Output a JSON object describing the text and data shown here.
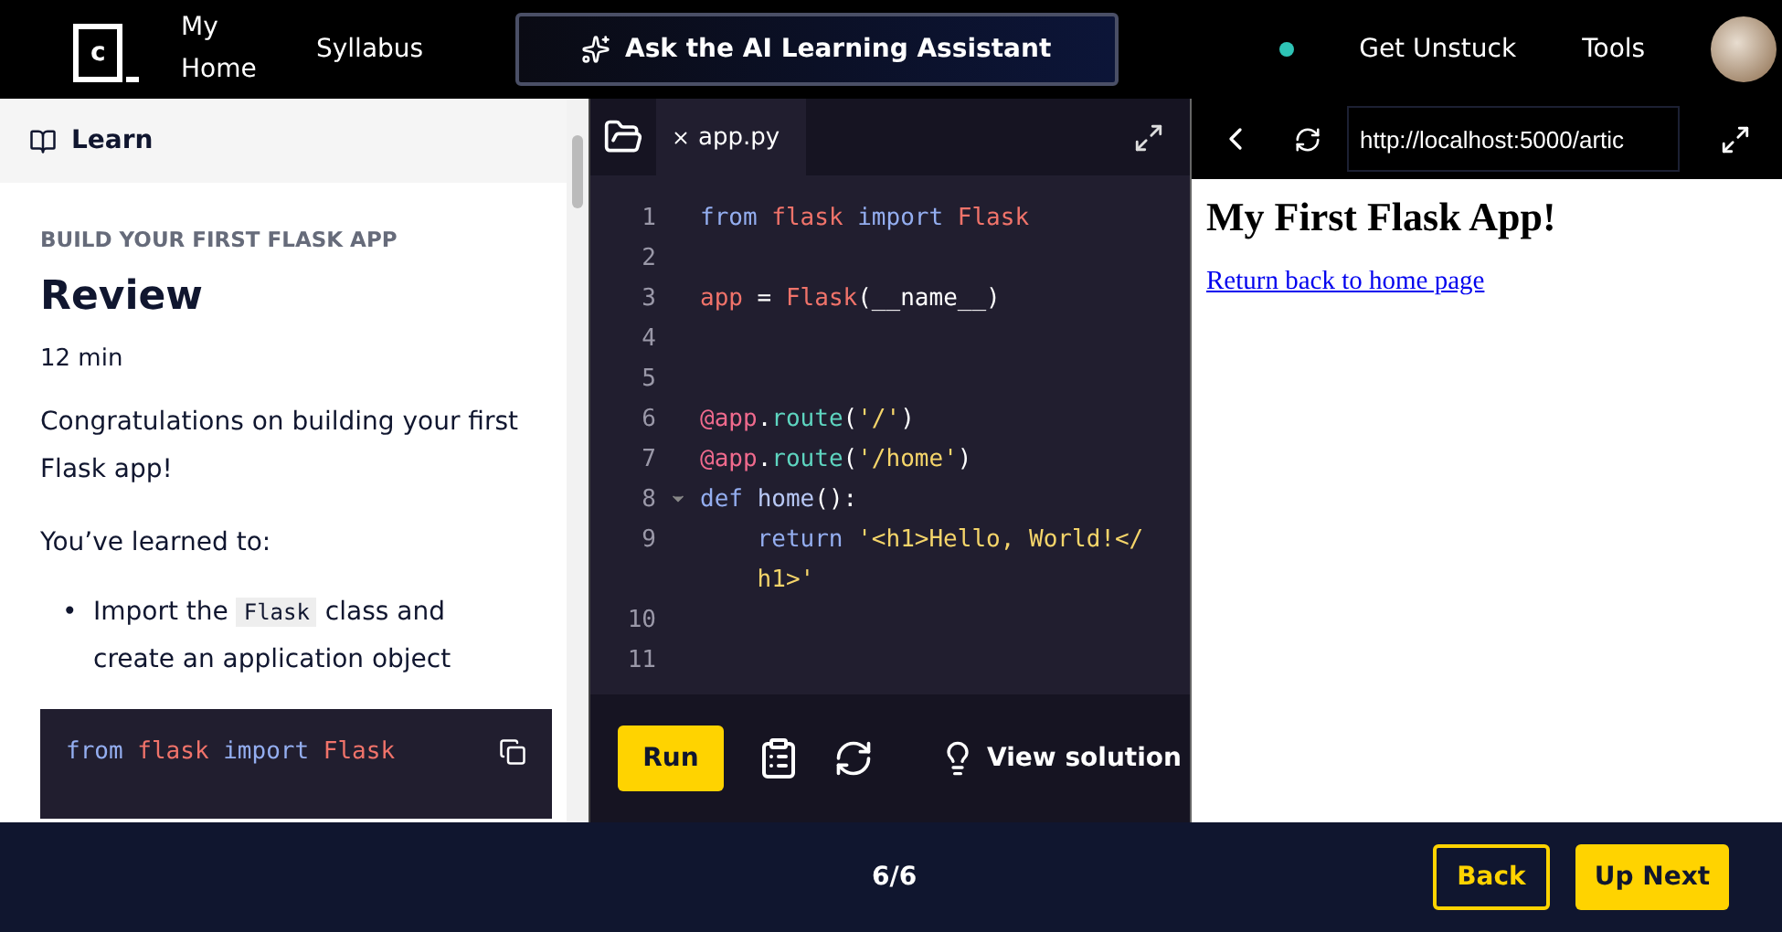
{
  "header": {
    "logo": "c",
    "nav": [
      {
        "label": "My Home"
      },
      {
        "label": "Syllabus"
      }
    ],
    "assistant_button": "Ask the AI Learning Assistant",
    "status_dot": {
      "color": "#2ec4b6"
    },
    "links": [
      "Get Unstuck",
      "Tools"
    ]
  },
  "learn_panel": {
    "title": "Learn",
    "eyebrow": "BUILD YOUR FIRST FLASK APP",
    "heading": "Review",
    "duration": "12 min",
    "paragraphs": [
      "Congratulations on building your first Flask app!",
      "You’ve learned to:"
    ],
    "bullets": [
      [
        {
          "kind": "marker",
          "text": "•"
        },
        {
          "kind": "text",
          "text": "Import the "
        },
        {
          "kind": "code",
          "text": "Flask"
        },
        {
          "kind": "text",
          "text": " class and create an application object"
        }
      ]
    ],
    "snippet": [
      {
        "kind": "keyword",
        "text": "from "
      },
      {
        "kind": "name",
        "text": "flask "
      },
      {
        "kind": "keyword",
        "text": "import "
      },
      {
        "kind": "name",
        "text": "Flask"
      }
    ]
  },
  "editor": {
    "tab": {
      "label": "app.py",
      "selected": true
    },
    "lines": [
      {
        "number": "1",
        "tokens": [
          {
            "kind": "keyword",
            "text": "from "
          },
          {
            "kind": "name",
            "text": "flask "
          },
          {
            "kind": "keyword",
            "text": "import "
          },
          {
            "kind": "name",
            "text": "Flask"
          }
        ]
      },
      {
        "number": "2"
      },
      {
        "number": "3",
        "tokens": [
          {
            "kind": "name",
            "text": "app"
          },
          {
            "kind": "plain",
            "text": " = "
          },
          {
            "kind": "name",
            "text": "Flask"
          },
          {
            "kind": "plain",
            "text": "(__name__)"
          }
        ]
      },
      {
        "number": "4"
      },
      {
        "number": "5"
      },
      {
        "number": "6",
        "tokens": [
          {
            "kind": "decorator",
            "text": "@app"
          },
          {
            "kind": "plain",
            "text": "."
          },
          {
            "kind": "func",
            "text": "route"
          },
          {
            "kind": "plain",
            "text": "("
          },
          {
            "kind": "string",
            "text": "'/'"
          },
          {
            "kind": "plain",
            "text": ")"
          }
        ]
      },
      {
        "number": "7",
        "tokens": [
          {
            "kind": "decorator",
            "text": "@app"
          },
          {
            "kind": "plain",
            "text": "."
          },
          {
            "kind": "func",
            "text": "route"
          },
          {
            "kind": "plain",
            "text": "("
          },
          {
            "kind": "string",
            "text": "'/home'"
          },
          {
            "kind": "plain",
            "text": ")"
          }
        ]
      },
      {
        "number": "8",
        "expanded": true,
        "tokens": [
          {
            "kind": "keyword",
            "text": "def "
          },
          {
            "kind": "ident",
            "text": "home"
          },
          {
            "kind": "plain",
            "text": "():"
          }
        ]
      },
      {
        "number": "9",
        "indented": true,
        "tokens": [
          {
            "kind": "keyword",
            "text": "return "
          },
          {
            "kind": "string",
            "text": "'<h1>Hello, World!</"
          }
        ]
      },
      {
        "indented": true,
        "tokens": [
          {
            "kind": "string",
            "text": "h1>'"
          }
        ]
      },
      {
        "number": "10"
      },
      {
        "number": "11"
      }
    ],
    "run": "Run",
    "solution": "View solution"
  },
  "browser": {
    "url": "http://localhost:5000/artic",
    "heading": "My First Flask App!",
    "link": "Return back to home page"
  },
  "footer": {
    "progress": "6/6",
    "back": "Back",
    "next": "Up Next"
  }
}
